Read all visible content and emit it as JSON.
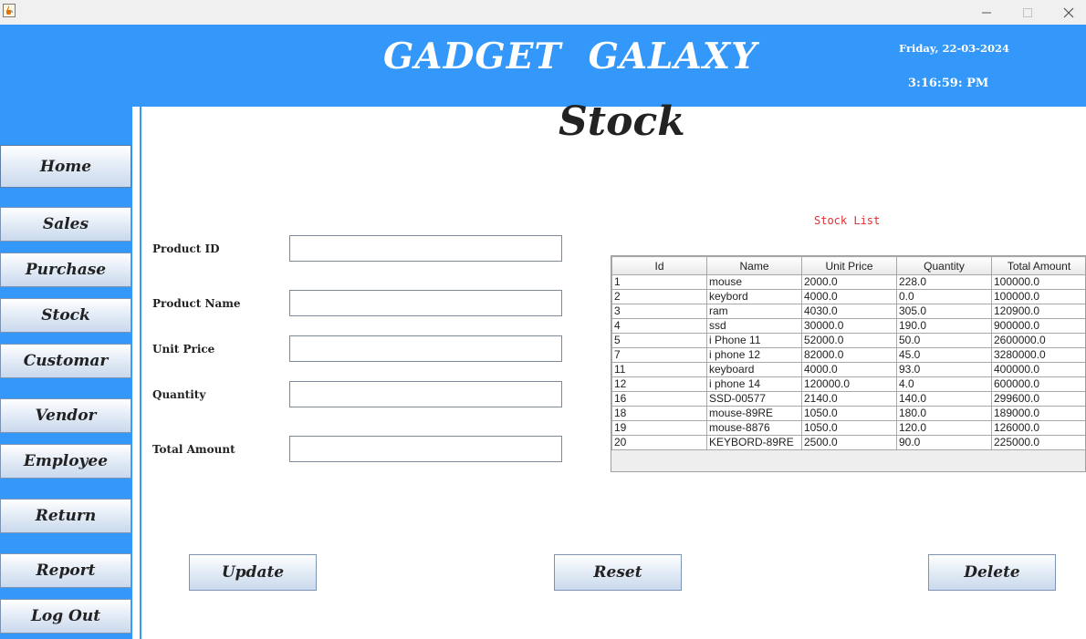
{
  "window": {
    "icon": "java-cup-icon",
    "controls": [
      "minimize-icon",
      "maximize-icon",
      "close-icon"
    ]
  },
  "header": {
    "brand": "GADGET  GALAXY",
    "date": "Friday, 22-03-2024",
    "time": "3:16:59: PM"
  },
  "nav": {
    "home": "Home",
    "sales": "Sales",
    "purchase": "Purchase",
    "stock": "Stock",
    "customar": "Customar",
    "vendor": "Vendor",
    "employee": "Employee",
    "return": "Return",
    "report": "Report",
    "logout": "Log Out"
  },
  "page": {
    "title": "Stock",
    "list_caption": "Stock List"
  },
  "form": {
    "product_id_label": "Product ID",
    "product_id_value": "",
    "product_name_label": "Product Name",
    "product_name_value": "",
    "unit_price_label": "Unit Price",
    "unit_price_value": "",
    "quantity_label": "Quantity",
    "quantity_value": "",
    "total_amount_label": "Total Amount",
    "total_amount_value": ""
  },
  "table": {
    "headers": [
      "Id",
      "Name",
      "Unit Price",
      "Quantity",
      "Total Amount"
    ],
    "rows": [
      [
        "1",
        "mouse",
        "2000.0",
        "228.0",
        "100000.0"
      ],
      [
        "2",
        "keybord",
        "4000.0",
        "0.0",
        "100000.0"
      ],
      [
        "3",
        "ram",
        "4030.0",
        "305.0",
        "120900.0"
      ],
      [
        "4",
        "ssd",
        "30000.0",
        "190.0",
        "900000.0"
      ],
      [
        "5",
        "i Phone 11",
        "52000.0",
        "50.0",
        "2600000.0"
      ],
      [
        "7",
        "i phone 12",
        "82000.0",
        "45.0",
        "3280000.0"
      ],
      [
        "11",
        "keyboard",
        "4000.0",
        "93.0",
        "400000.0"
      ],
      [
        "12",
        "i phone 14",
        "120000.0",
        "4.0",
        "600000.0"
      ],
      [
        "16",
        "SSD-00577",
        "2140.0",
        "140.0",
        "299600.0"
      ],
      [
        "18",
        "mouse-89RE",
        "1050.0",
        "180.0",
        "189000.0"
      ],
      [
        "19",
        "mouse-8876",
        "1050.0",
        "120.0",
        "126000.0"
      ],
      [
        "20",
        "KEYBORD-89RE",
        "2500.0",
        "90.0",
        "225000.0"
      ]
    ]
  },
  "actions": {
    "update": "Update",
    "reset": "Reset",
    "delete": "Delete"
  },
  "colors": {
    "accent": "#3498fa",
    "caption": "#e03030"
  }
}
